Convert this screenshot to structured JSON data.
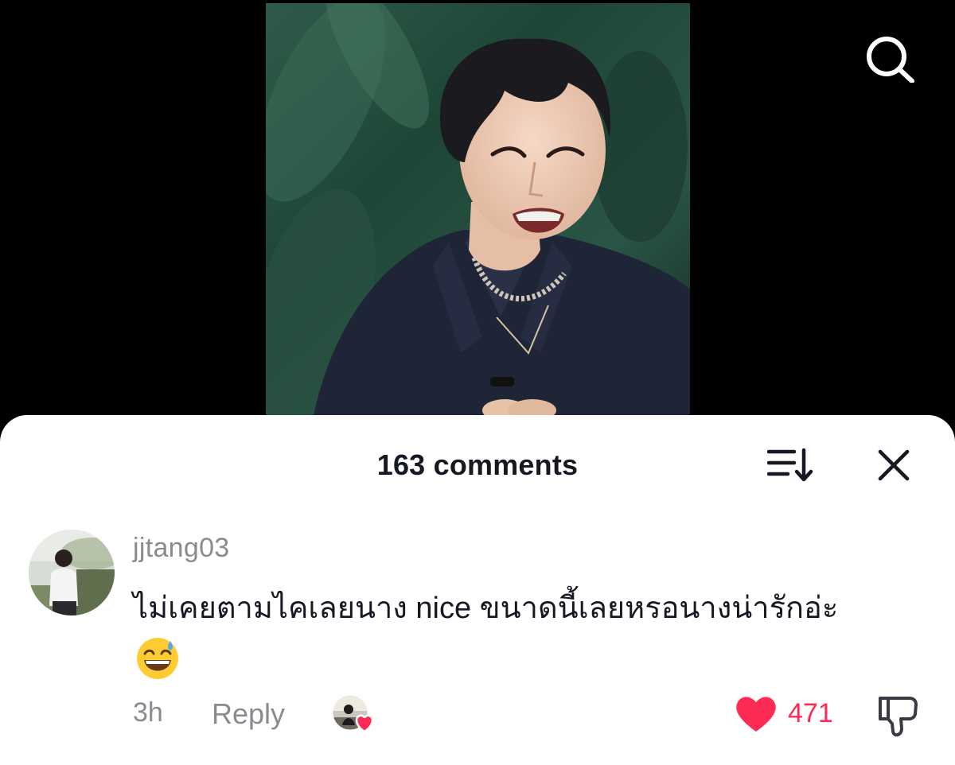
{
  "video": {
    "description_icon": "video-frame"
  },
  "header": {
    "search_icon": "search-icon"
  },
  "comments_sheet": {
    "title": "163 comments",
    "sort_icon": "sort-icon",
    "close_icon": "close-icon"
  },
  "comment": {
    "username": "jjtang03",
    "text": "ไม่เคยตามไคเลยนาง nice ขนาดนี้เลยหรอนางน่ารักอ่ะ",
    "emoji": "grinning-face-with-sweat-emoji",
    "time": "3h",
    "reply_label": "Reply",
    "creator_liked_icon": "creator-liked-icon",
    "likes": "471",
    "like_icon": "heart-icon",
    "dislike_icon": "thumbs-down-icon"
  },
  "colors": {
    "accent": "#fe2c55",
    "text_primary": "#161823",
    "text_secondary": "#8a8b91",
    "background_top": "#000000",
    "sheet_background": "#ffffff"
  }
}
